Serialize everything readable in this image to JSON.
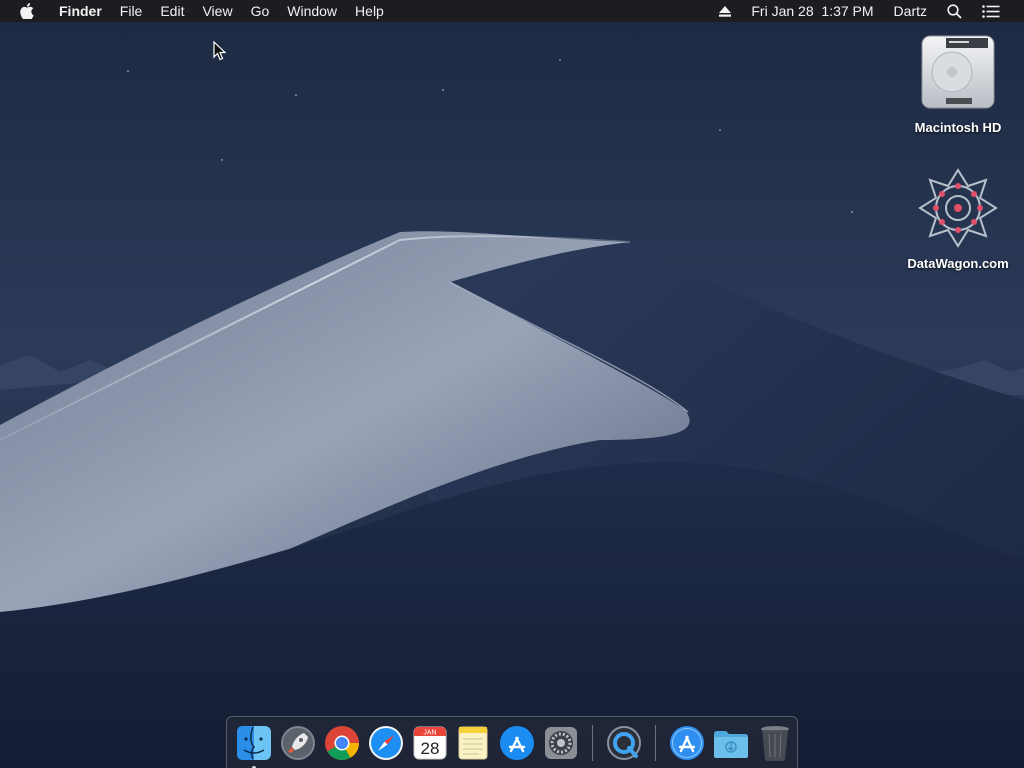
{
  "menubar": {
    "app_name": "Finder",
    "menus": [
      "File",
      "Edit",
      "View",
      "Go",
      "Window",
      "Help"
    ],
    "clock": "Fri Jan 28  1:37 PM",
    "user": "Dartz",
    "icons": [
      "apple-logo-icon",
      "eject-icon",
      "spotlight-search-icon",
      "notification-center-icon"
    ]
  },
  "desktop": {
    "icons": [
      {
        "label": "Macintosh HD",
        "icon": "hard-drive-icon"
      },
      {
        "label": "DataWagon.com",
        "icon": "datawagon-logo-icon"
      }
    ]
  },
  "dock": {
    "apps": [
      {
        "name": "finder",
        "icon": "finder-icon",
        "running": true
      },
      {
        "name": "launchpad",
        "icon": "launchpad-icon",
        "running": false
      },
      {
        "name": "chrome",
        "icon": "chrome-icon",
        "running": false
      },
      {
        "name": "safari",
        "icon": "safari-icon",
        "running": false
      },
      {
        "name": "calendar",
        "icon": "calendar-icon",
        "running": false,
        "month": "JAN",
        "day": "28"
      },
      {
        "name": "notes",
        "icon": "notes-icon",
        "running": false
      },
      {
        "name": "app-store",
        "icon": "app-store-icon",
        "running": false
      },
      {
        "name": "system-preferences",
        "icon": "system-preferences-icon",
        "running": false
      },
      {
        "name": "quicktime",
        "icon": "quicktime-icon",
        "running": false
      },
      {
        "name": "applications-folder",
        "icon": "applications-folder-icon",
        "running": false
      },
      {
        "name": "downloads-folder",
        "icon": "downloads-folder-icon",
        "running": false
      },
      {
        "name": "trash",
        "icon": "trash-icon",
        "running": false
      }
    ]
  },
  "colors": {
    "menubar_bg": "#1c1c1e",
    "sky_top": "#223049",
    "dune_light": "#8c97ad",
    "dune_dark": "#1d2a44"
  }
}
